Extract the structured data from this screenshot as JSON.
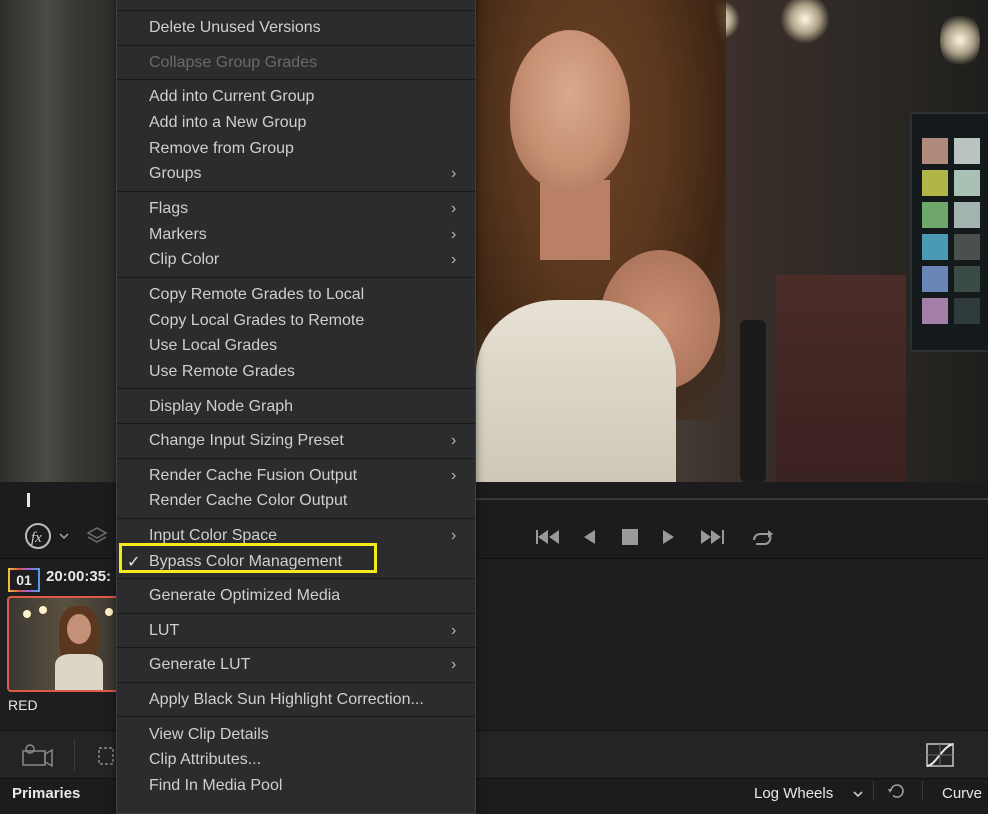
{
  "menu": {
    "items": [
      {
        "label": "Delete Unused Versions",
        "disabled": false
      },
      {
        "label": "Collapse Group Grades",
        "disabled": true
      },
      {
        "label": "Add into Current Group",
        "disabled": false
      },
      {
        "label": "Add into a New Group",
        "disabled": false
      },
      {
        "label": "Remove from Group",
        "disabled": false
      },
      {
        "label": "Groups",
        "submenu": true
      },
      {
        "label": "Flags",
        "submenu": true
      },
      {
        "label": "Markers",
        "submenu": true
      },
      {
        "label": "Clip Color",
        "submenu": true
      },
      {
        "label": "Copy Remote Grades to Local"
      },
      {
        "label": "Copy Local Grades to Remote"
      },
      {
        "label": "Use Local Grades"
      },
      {
        "label": "Use Remote Grades"
      },
      {
        "label": "Display Node Graph"
      },
      {
        "label": "Change Input Sizing Preset",
        "submenu": true
      },
      {
        "label": "Render Cache Fusion Output",
        "submenu": true
      },
      {
        "label": "Render Cache Color Output"
      },
      {
        "label": "Input Color Space",
        "submenu": true
      },
      {
        "label": "Bypass Color Management",
        "checked": true
      },
      {
        "label": "Generate Optimized Media"
      },
      {
        "label": "LUT",
        "submenu": true
      },
      {
        "label": "Generate LUT",
        "submenu": true
      },
      {
        "label": "Apply Black Sun Highlight Correction..."
      },
      {
        "label": "View Clip Details"
      },
      {
        "label": "Clip Attributes..."
      },
      {
        "label": "Find In Media Pool"
      }
    ],
    "check_mark": "✓",
    "submenu_glyph": "›"
  },
  "clip": {
    "number": "01",
    "timecode": "20:00:35:",
    "label": "RED"
  },
  "tabs": {
    "primaries": "Primaries",
    "log_wheels": "Log Wheels",
    "curves": "Curve"
  },
  "icons": {
    "fx": "fx-icon",
    "layers": "layers-icon",
    "skip_back": "skip-to-start-icon",
    "prev": "play-reverse-icon",
    "stop": "stop-icon",
    "play": "play-icon",
    "skip_fwd": "skip-to-end-icon",
    "loop": "loop-icon"
  },
  "colors": {
    "highlight": "#f5ea1a",
    "menu_bg": "#2c2c2e",
    "menu_text": "#cfcfcf",
    "clip_border": "#e05a4a"
  }
}
